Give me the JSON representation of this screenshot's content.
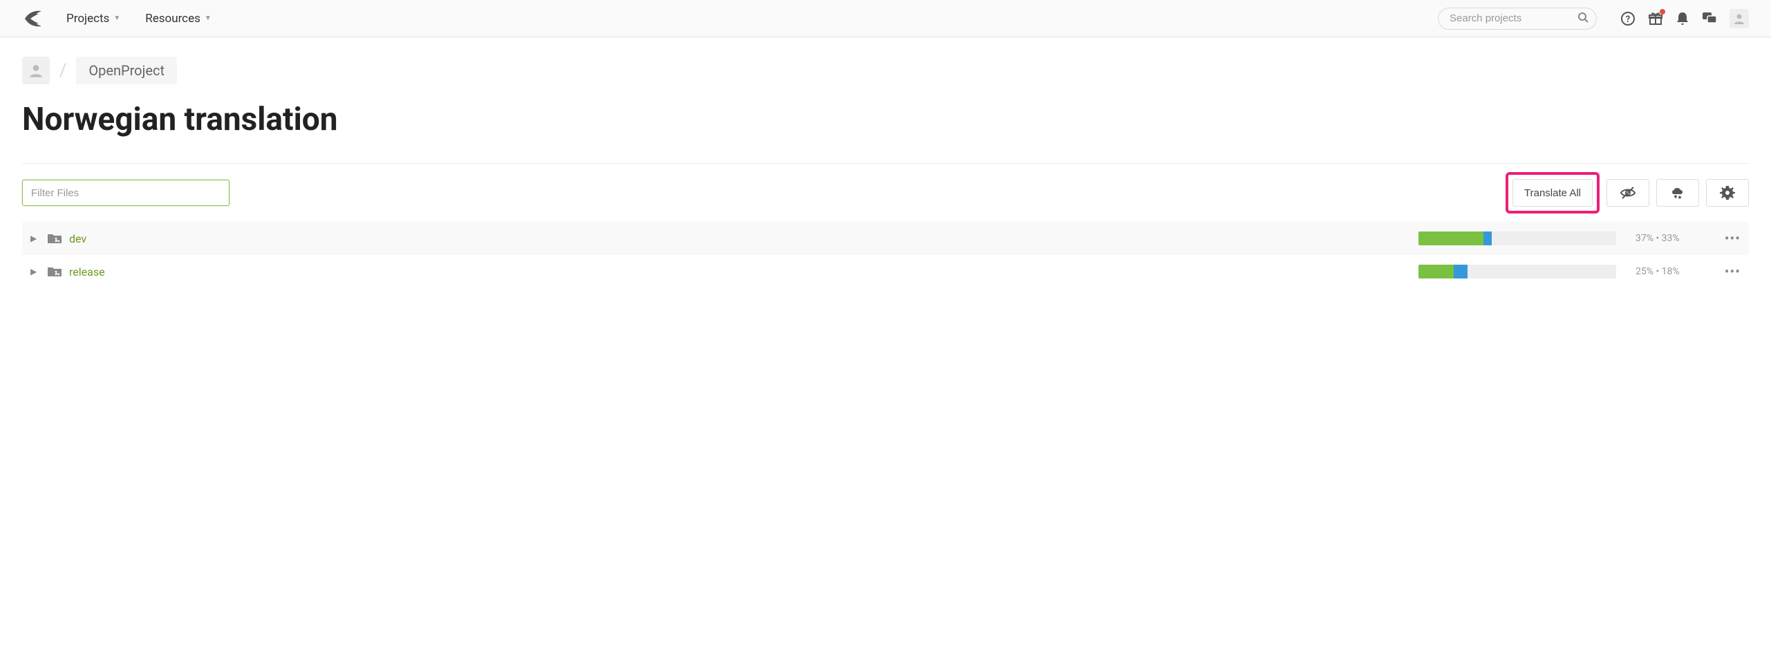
{
  "nav": {
    "projects": "Projects",
    "resources": "Resources"
  },
  "search": {
    "placeholder": "Search projects"
  },
  "breadcrumb": {
    "project": "OpenProject"
  },
  "page": {
    "title": "Norwegian translation"
  },
  "toolbar": {
    "filter_placeholder": "Filter Files",
    "translate_all": "Translate All"
  },
  "rows": [
    {
      "name": "dev",
      "green_pct": 33,
      "blue_pct": 4,
      "stat1": "37%",
      "stat2": "33%"
    },
    {
      "name": "release",
      "green_pct": 18,
      "blue_pct": 7,
      "stat1": "25%",
      "stat2": "18%"
    }
  ]
}
